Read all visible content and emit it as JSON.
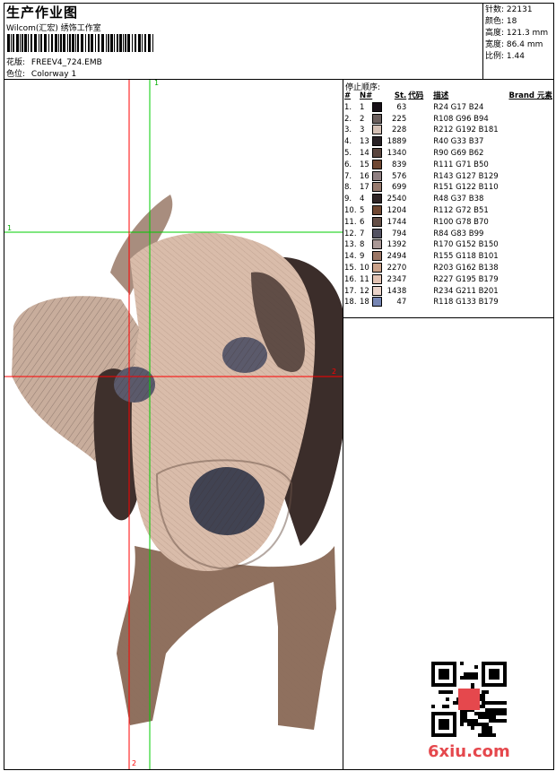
{
  "header": {
    "title": "生产作业图",
    "company": "Wilcom(汇宏) 绣饰工作室",
    "design_label": "花版:",
    "design_value": "FREEV4_724.EMB",
    "colorway_label": "色位:",
    "colorway_value": "Colorway 1"
  },
  "stats": [
    {
      "label": "针数:",
      "value": "22131"
    },
    {
      "label": "颜色:",
      "value": "18"
    },
    {
      "label": "高度:",
      "value": "121.3 mm"
    },
    {
      "label": "宽度:",
      "value": "86.4 mm"
    },
    {
      "label": "比例:",
      "value": "1.44"
    }
  ],
  "stop_sequence": {
    "title": "停止顺序:",
    "headers": {
      "index": "#",
      "n": "N#",
      "st": "St.",
      "code": "代码",
      "desc": "描述",
      "brand": "Brand",
      "element": "元素"
    },
    "rows": [
      {
        "index": "1.",
        "n": "1",
        "st": "63",
        "desc": "R24 G17 B24",
        "color": "#181118"
      },
      {
        "index": "2.",
        "n": "2",
        "st": "225",
        "desc": "R108 G96 B94",
        "color": "#6c605e"
      },
      {
        "index": "3.",
        "n": "3",
        "st": "228",
        "desc": "R212 G192 B181",
        "color": "#d4c0b5"
      },
      {
        "index": "4.",
        "n": "13",
        "st": "1889",
        "desc": "R40 G33 B37",
        "color": "#282125"
      },
      {
        "index": "5.",
        "n": "14",
        "st": "1340",
        "desc": "R90 G69 B62",
        "color": "#5a453e"
      },
      {
        "index": "6.",
        "n": "15",
        "st": "839",
        "desc": "R111 G71 B50",
        "color": "#6f4732"
      },
      {
        "index": "7.",
        "n": "16",
        "st": "576",
        "desc": "R143 G127 B129",
        "color": "#8f7f81"
      },
      {
        "index": "8.",
        "n": "17",
        "st": "699",
        "desc": "R151 G122 B110",
        "color": "#977a6e"
      },
      {
        "index": "9.",
        "n": "4",
        "st": "2540",
        "desc": "R48 G37 B38",
        "color": "#302526"
      },
      {
        "index": "10.",
        "n": "5",
        "st": "1204",
        "desc": "R112 G72 B51",
        "color": "#704833"
      },
      {
        "index": "11.",
        "n": "6",
        "st": "1744",
        "desc": "R100 G78 B70",
        "color": "#644e46"
      },
      {
        "index": "12.",
        "n": "7",
        "st": "794",
        "desc": "R84 G83 B99",
        "color": "#545363"
      },
      {
        "index": "13.",
        "n": "8",
        "st": "1392",
        "desc": "R170 G152 B150",
        "color": "#aa9896"
      },
      {
        "index": "14.",
        "n": "9",
        "st": "2494",
        "desc": "R155 G118 B101",
        "color": "#9b7665"
      },
      {
        "index": "15.",
        "n": "10",
        "st": "2270",
        "desc": "R203 G162 B138",
        "color": "#cba28a"
      },
      {
        "index": "16.",
        "n": "11",
        "st": "2347",
        "desc": "R227 G195 B179",
        "color": "#e3c3b3"
      },
      {
        "index": "17.",
        "n": "12",
        "st": "1438",
        "desc": "R234 G211 B201",
        "color": "#ead3c9"
      },
      {
        "index": "18.",
        "n": "18",
        "st": "47",
        "desc": "R118 G133 B179",
        "color": "#7685b3"
      }
    ]
  },
  "guides": {
    "vertical_green": "1",
    "horizontal_green": "1",
    "horizontal_red": "2",
    "vertical_red": "2"
  },
  "watermark": "6xiu.com"
}
